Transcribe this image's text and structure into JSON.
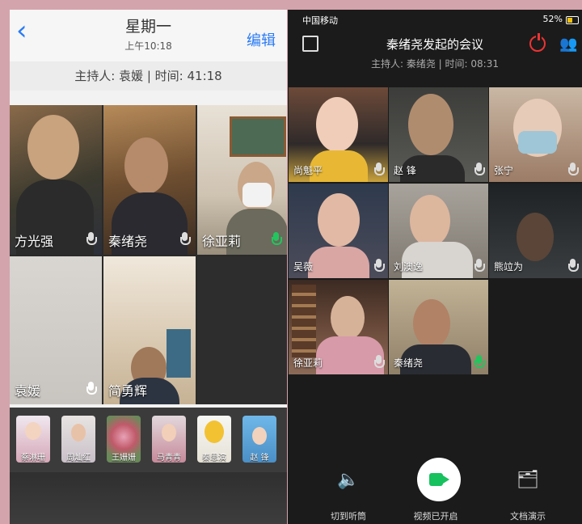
{
  "left": {
    "back": "‹",
    "day": "星期一",
    "time": "上午10:18",
    "edit": "编辑",
    "host_line": "主持人: 袁媛 | 时间: 41:18",
    "tiles": [
      "方光强",
      "秦绪尧",
      "徐亚莉",
      "袁媛",
      "简勇辉"
    ],
    "thumbs": [
      "蔡淋珊",
      "周灿红",
      "王姗姗",
      "马青青",
      "秦思演",
      "赵 锋"
    ]
  },
  "right": {
    "carrier": "中国移动",
    "battery": "52%",
    "title": "秦绪尧发起的会议",
    "subtitle": "主持人: 秦绪尧 | 时间: 08:31",
    "tiles": [
      "尚魁平",
      "赵 锋",
      "张宁",
      "吴薇",
      "刘澳逸",
      "熊竝为",
      "徐亚莉",
      "秦绪尧"
    ],
    "controls": {
      "handset": "切到听筒",
      "video": "视频已开启",
      "share": "文档演示"
    }
  },
  "colors": {
    "accent_blue": "#2a7bf6",
    "mic_active": "#22c55e",
    "wechat_green": "#17c15e",
    "power_red": "#e33333"
  }
}
